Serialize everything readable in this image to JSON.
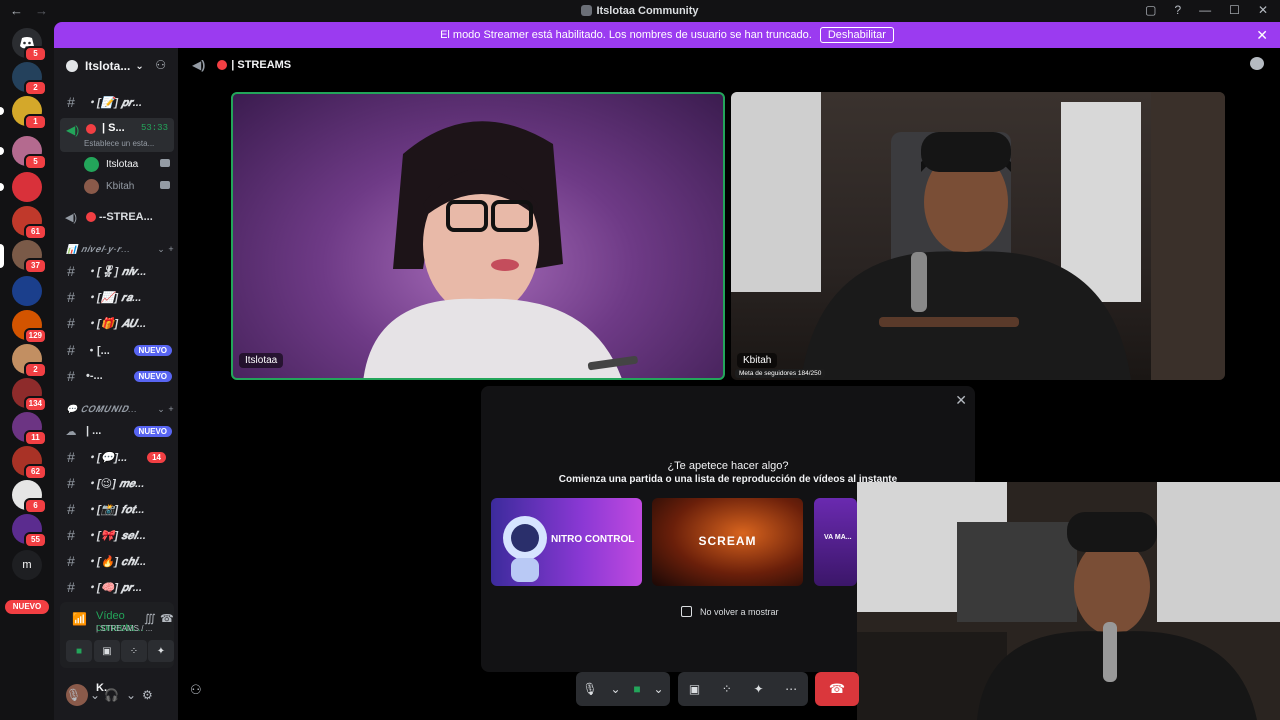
{
  "window": {
    "title": "Itslotaa Community",
    "nav_back": "←",
    "nav_forward": "→",
    "controls": [
      "▢",
      "?",
      "—",
      "☐",
      "✕"
    ]
  },
  "banner": {
    "text": "El modo Streamer está habilitado. Los nombres de usuario se han truncado.",
    "button": "Deshabilitar",
    "close": "✕"
  },
  "rail": {
    "nuevo": "NUEVO",
    "servers": [
      {
        "badge": "5"
      },
      {
        "badge": "2"
      },
      {
        "badge": "1"
      },
      {
        "badge": "5"
      },
      {
        "badge": ""
      },
      {
        "badge": "61"
      },
      {
        "badge": "37"
      },
      {
        "badge": ""
      },
      {
        "badge": "129"
      },
      {
        "badge": "2"
      },
      {
        "badge": "134"
      },
      {
        "badge": "11"
      },
      {
        "badge": "62"
      },
      {
        "badge": "6"
      },
      {
        "badge": "55"
      },
      {
        "badge": "",
        "letter": "m"
      }
    ]
  },
  "sidebar": {
    "server_name": "Itslota...",
    "server_chevron": "⌄",
    "channels": [
      {
        "name": "・[📝] 𝒑𝒓...",
        "badge": ""
      },
      {
        "name": "--STREA...",
        "badge": ""
      },
      {
        "name": "・[🎖] 𝒏𝒊𝒗...",
        "badge": ""
      },
      {
        "name": "・[📈] 𝒓𝒂...",
        "badge": ""
      },
      {
        "name": "・[🎁] 𝑨𝑼...",
        "badge": ""
      },
      {
        "name": "・[...",
        "badge": "NUEVO"
      },
      {
        "name": "•-...",
        "badge": "NUEVO"
      },
      {
        "name": "| ...",
        "badge": "NUEVO"
      },
      {
        "name": "・[💬]...",
        "badge": "14"
      },
      {
        "name": "・[😉] 𝒎𝒆...",
        "badge": ""
      },
      {
        "name": "・[📸] 𝒇𝒐𝒕...",
        "badge": ""
      },
      {
        "name": "・[🎀] 𝒔𝒆𝒍...",
        "badge": ""
      },
      {
        "name": "・[🔥] 𝒄𝒉𝒊...",
        "badge": ""
      },
      {
        "name": "・[🧠] 𝒑𝒓...",
        "badge": ""
      }
    ],
    "categories": [
      {
        "name": "📊 𝒏𝒊𝒗𝒆𝒍-𝒚-𝒓...",
        "plus": "⌄ +"
      },
      {
        "name": "💬 𝑪𝑶𝑴𝑼𝑵𝑰𝑫...",
        "plus": "⌄ +"
      }
    ],
    "active_voice": {
      "name": "| S...",
      "time": "53:33",
      "status": "Establece un esta..."
    },
    "voice_users": [
      {
        "name": "Itslotaa"
      },
      {
        "name": "Kbitah"
      }
    ],
    "voice_panel": {
      "title": "Vídeo conecta...",
      "subtitle": "| STREAMS / ..."
    },
    "user": {
      "name": "K."
    }
  },
  "main": {
    "channel_title": "| STREAMS",
    "tiles": [
      {
        "name": "Itslotaa"
      },
      {
        "name": "Kbitah",
        "overlay": "Meta de seguidores 184/250"
      }
    ],
    "activity": {
      "question": "¿Te apetece hacer algo?",
      "subtitle": "Comienza una partida o una lista de reproducción de vídeos al instante",
      "games": [
        {
          "title": "NITRO CONTROL"
        },
        {
          "title": "SCREAM"
        },
        {
          "title": "VA MA..."
        }
      ],
      "checkbox": "No volver a mostrar"
    }
  },
  "colors": {
    "accent": "#9b3bf0",
    "green": "#23a55a",
    "red": "#f23f43",
    "blurple": "#5865f2"
  }
}
